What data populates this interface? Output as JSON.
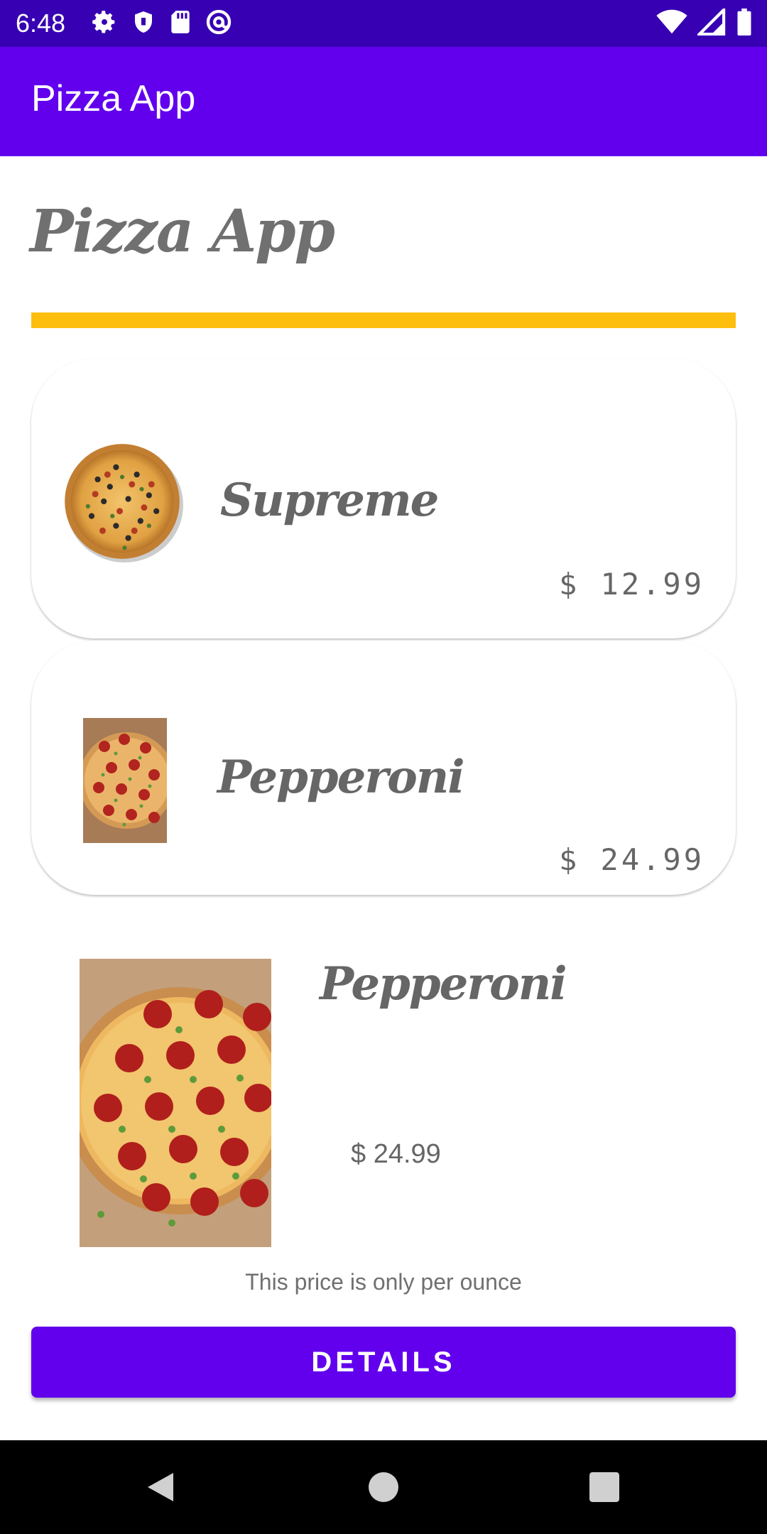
{
  "status_bar": {
    "time": "6:48",
    "icons_left": [
      "gear-icon",
      "shield-icon",
      "sd-card-icon",
      "at-sign-icon"
    ],
    "icons_right": [
      "wifi-icon",
      "signal-icon",
      "battery-icon"
    ]
  },
  "app_bar": {
    "title": "Pizza App"
  },
  "header": {
    "title": "Pizza App"
  },
  "accent_color": "#fdbe0e",
  "primary_color": "#6200ee",
  "list": {
    "items": [
      {
        "name": "Supreme",
        "price": "$ 12.99",
        "image_icon": "supreme-pizza-image"
      },
      {
        "name": "Pepperoni",
        "price": "$ 24.99",
        "image_icon": "pepperoni-pizza-image"
      }
    ]
  },
  "detail": {
    "name": "Pepperoni",
    "price": "$ 24.99",
    "note": "This price is only per ounce",
    "button_label": "DETAILS"
  },
  "nav_bar": {
    "buttons": [
      "back-icon",
      "home-icon",
      "recents-icon"
    ]
  }
}
